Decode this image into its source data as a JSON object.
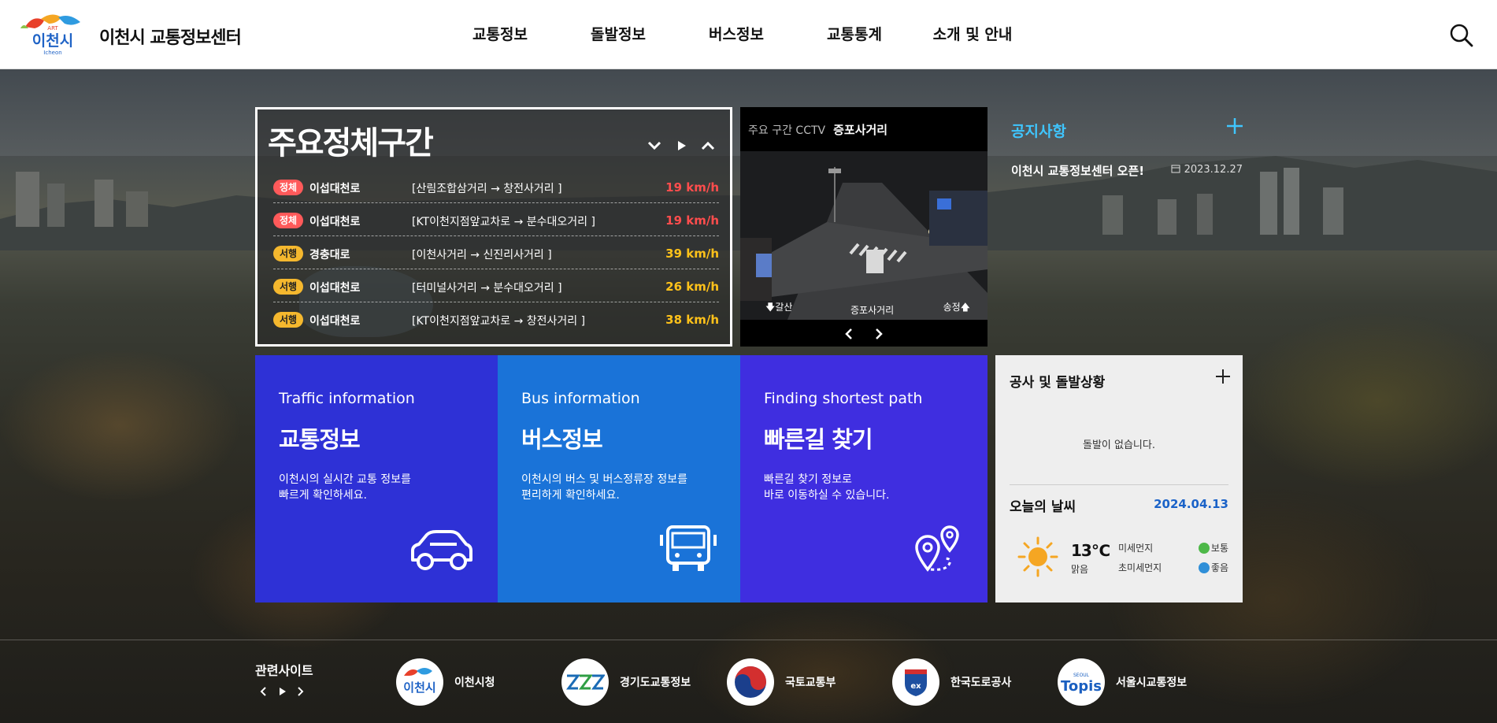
{
  "header": {
    "logo_alt": "이천시 Icheon",
    "title": "이천시 교통정보센터",
    "nav": [
      "교통정보",
      "돌발정보",
      "버스정보",
      "교통통계",
      "소개 및 안내"
    ],
    "search_icon": "search-icon"
  },
  "congestion": {
    "title": "주요정체구간",
    "rows": [
      {
        "status": "정체",
        "color": "red",
        "road": "이섭대천로",
        "section": "[산림조합삼거리 → 창전사거리 ]",
        "speed": "19 km/h"
      },
      {
        "status": "정체",
        "color": "red",
        "road": "이섭대천로",
        "section": "[KT이천지점앞교차로 → 분수대오거리 ]",
        "speed": "19 km/h"
      },
      {
        "status": "서행",
        "color": "yellow",
        "road": "경충대로",
        "section": "[이천사거리 → 신진리사거리 ]",
        "speed": "39 km/h"
      },
      {
        "status": "서행",
        "color": "yellow",
        "road": "이섭대천로",
        "section": "[터미널사거리 → 분수대오거리 ]",
        "speed": "26 km/h"
      },
      {
        "status": "서행",
        "color": "yellow",
        "road": "이섭대천로",
        "section": "[KT이천지점앞교차로 → 창전사거리 ]",
        "speed": "38 km/h"
      }
    ]
  },
  "cctv": {
    "label": "주요 구간 CCTV",
    "location": "증포사거리",
    "caption_left": "🡇갈산",
    "caption_center": "증포사거리",
    "caption_right": "송정🡅"
  },
  "notice": {
    "title": "공지사항",
    "item": "이천시 교통정보센터 오픈!",
    "date": "2023.12.27"
  },
  "cards": [
    {
      "en": "Traffic information",
      "ko": "교통정보",
      "desc": "이천시의 실시간 교통 정보를\n빠르게 확인하세요.",
      "icon": "car-icon"
    },
    {
      "en": "Bus information",
      "ko": "버스정보",
      "desc": "이천시의 버스 및 버스정류장 정보를\n편리하게 확인하세요.",
      "icon": "bus-icon"
    },
    {
      "en": "Finding shortest path",
      "ko": "빠른길 찾기",
      "desc": "빠른길 찾기 정보로\n바로 이동하실 수 있습니다.",
      "icon": "route-pin-icon"
    }
  ],
  "incident": {
    "title": "공사 및 돌발상황",
    "empty": "돌발이 없습니다."
  },
  "weather": {
    "title": "오늘의 날씨",
    "date": "2024.04.13",
    "temp": "13℃",
    "condition": "맑음",
    "fine_dust_label": "미세먼지",
    "fine_dust_value": "보통",
    "ultra_dust_label": "초미세먼지",
    "ultra_dust_value": "좋음",
    "colors": {
      "normal": "#4db848",
      "good": "#2f8fd8",
      "sun": "#f5a623"
    }
  },
  "related": {
    "title": "관련사이트",
    "sites": [
      {
        "name": "이천시청",
        "icon": "icheon-logo-icon"
      },
      {
        "name": "경기도교통정보",
        "icon": "gyeonggi-logo-icon"
      },
      {
        "name": "국토교통부",
        "icon": "molit-logo-icon"
      },
      {
        "name": "한국도로공사",
        "icon": "ex-logo-icon"
      },
      {
        "name": "서울시교통정보",
        "icon": "topis-logo-icon"
      }
    ]
  }
}
